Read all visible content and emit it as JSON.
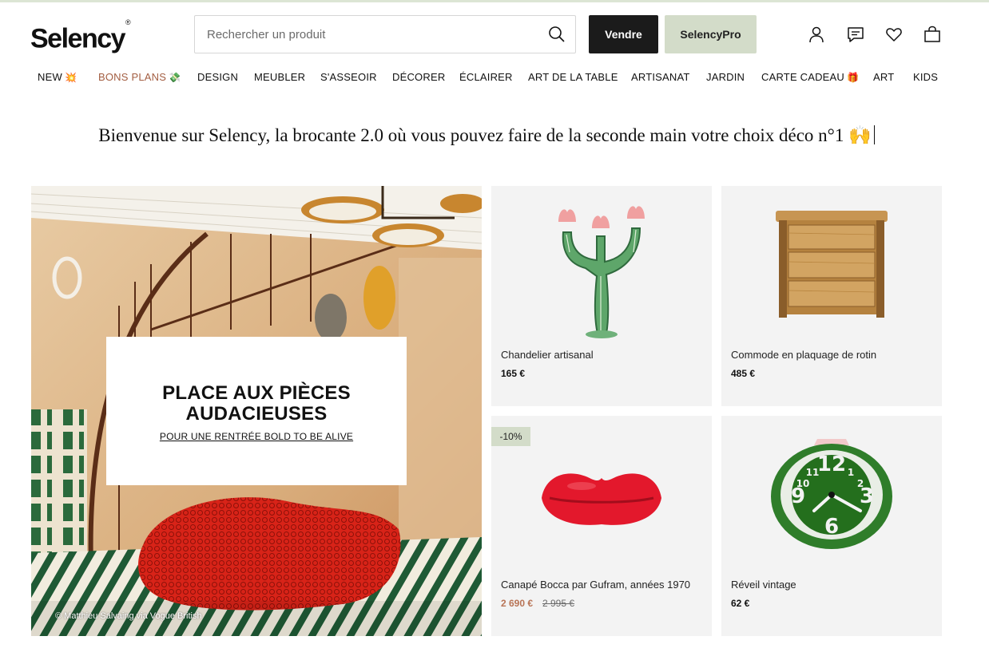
{
  "header": {
    "logo": "Selency",
    "logo_mark": "®",
    "search_placeholder": "Rechercher un produit",
    "sell_label": "Vendre",
    "pro_label": "SelencyPro",
    "icons": [
      "user-icon",
      "messages-icon",
      "heart-icon",
      "bag-icon"
    ]
  },
  "nav": {
    "items": [
      {
        "label": "NEW",
        "emoji": "💥"
      },
      {
        "label": "BONS PLANS",
        "emoji": "💸"
      },
      {
        "label": "DESIGN"
      },
      {
        "label": "MEUBLER"
      },
      {
        "label": "S'ASSEOIR"
      },
      {
        "label": "DÉCORER"
      },
      {
        "label": "ÉCLAIRER"
      },
      {
        "label": "ART DE LA TABLE"
      },
      {
        "label": "ARTISANAT"
      },
      {
        "label": "JARDIN"
      },
      {
        "label": "CARTE CADEAU",
        "emoji": "🎁"
      },
      {
        "label": "ART"
      },
      {
        "label": "KIDS"
      }
    ]
  },
  "welcome": {
    "text": "Bienvenue sur Selency, la brocante 2.0 où vous pouvez faire de la seconde main votre choix déco n°1",
    "emoji": "🙌"
  },
  "hero": {
    "title": "PLACE AUX PIÈCES AUDACIEUSES",
    "link": "POUR UNE RENTRÉE BOLD TO BE ALIVE",
    "credit": "© Matthieu Salvaing via Vogue British"
  },
  "products": [
    {
      "title": "Chandelier artisanal",
      "price": "165 €"
    },
    {
      "title": "Commode en plaquage de rotin",
      "price": "485 €"
    },
    {
      "title": "Canapé Bocca par Gufram, années 1970",
      "price": "2 690 €",
      "old_price": "2 995 €",
      "badge": "-10%"
    },
    {
      "title": "Réveil vintage",
      "price": "62 €"
    }
  ],
  "colors": {
    "accent_sage": "#d3dcc9",
    "dark_button": "#1b1b1b",
    "promo_text": "#a35e42",
    "sale_price": "#b87456"
  }
}
